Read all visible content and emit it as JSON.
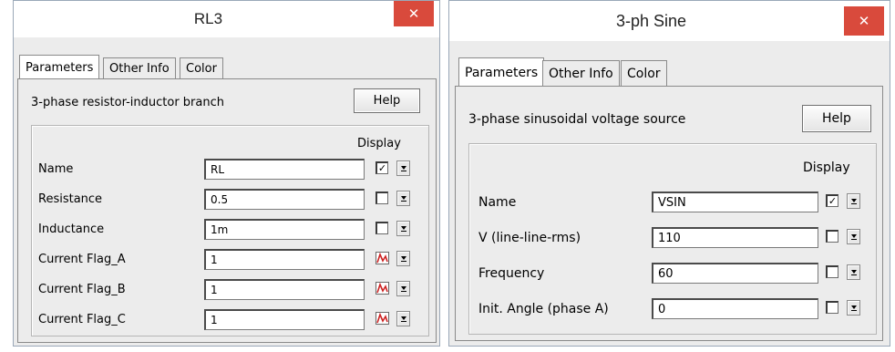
{
  "left_window": {
    "title": "RL3",
    "close_glyph": "✕",
    "tabs": [
      "Parameters",
      "Other Info",
      "Color"
    ],
    "active_tab": 0,
    "description": "3-phase resistor-inductor branch",
    "help_label": "Help",
    "display_header": "Display",
    "rows": [
      {
        "label": "Name",
        "value": "RL",
        "display": "check",
        "checked": true
      },
      {
        "label": "Resistance",
        "value": "0.5",
        "display": "check",
        "checked": false
      },
      {
        "label": "Inductance",
        "value": "1m",
        "display": "check",
        "checked": false
      },
      {
        "label": "Current Flag_A",
        "value": "1",
        "display": "flag",
        "checked": false
      },
      {
        "label": "Current Flag_B",
        "value": "1",
        "display": "flag",
        "checked": false
      },
      {
        "label": "Current Flag_C",
        "value": "1",
        "display": "flag",
        "checked": false
      }
    ]
  },
  "right_window": {
    "title": "3-ph Sine",
    "close_glyph": "✕",
    "tabs": [
      "Parameters",
      "Other Info",
      "Color"
    ],
    "active_tab": 0,
    "description": "3-phase sinusoidal voltage source",
    "help_label": "Help",
    "display_header": "Display",
    "rows": [
      {
        "label": "Name",
        "value": "VSIN",
        "display": "check",
        "checked": true
      },
      {
        "label": "V (line-line-rms)",
        "value": "110",
        "display": "check",
        "checked": false
      },
      {
        "label": "Frequency",
        "value": "60",
        "display": "check",
        "checked": false
      },
      {
        "label": "Init. Angle (phase A)",
        "value": "0",
        "display": "check",
        "checked": false
      }
    ]
  },
  "colors": {
    "close_button": "#d94a3c",
    "dialog_bg": "#ececec",
    "flag_icon": "#cc2222"
  },
  "icons": {
    "close": "close-icon",
    "checkbox": "checkbox-icon",
    "flag": "current-flag-icon",
    "dropdown": "dropdown-arrow-icon"
  }
}
